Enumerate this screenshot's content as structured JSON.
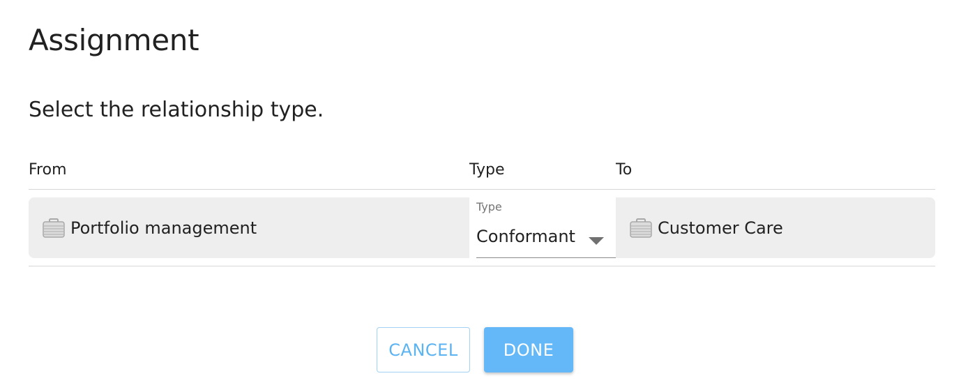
{
  "dialog": {
    "title": "Assignment",
    "subtitle": "Select the relationship type."
  },
  "columns": {
    "from": "From",
    "type": "Type",
    "to": "To"
  },
  "relationship": {
    "from": {
      "label": "Portfolio management",
      "icon": "briefcase-icon"
    },
    "type": {
      "field_label": "Type",
      "selected": "Conformant"
    },
    "to": {
      "label": "Customer Care",
      "icon": "briefcase-icon"
    }
  },
  "actions": {
    "cancel_label": "CANCEL",
    "done_label": "DONE"
  },
  "colors": {
    "accent": "#5cb3f2",
    "primary_button": "#64b8f7",
    "row_background": "#eeeeee"
  }
}
